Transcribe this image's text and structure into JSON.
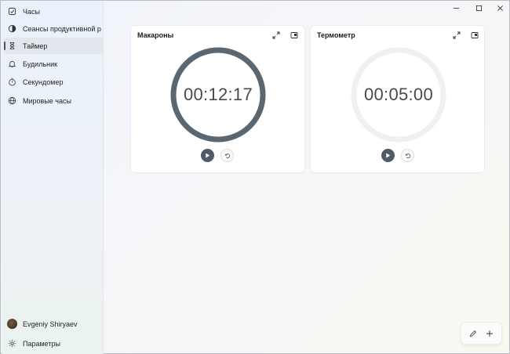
{
  "window": {
    "controls": [
      "minimize",
      "maximize",
      "close"
    ]
  },
  "sidebar": {
    "items": [
      {
        "label": "Часы",
        "icon": "clock-icon",
        "active": false
      },
      {
        "label": "Сеансы продуктивной р",
        "icon": "focus-icon",
        "active": false
      },
      {
        "label": "Таймер",
        "icon": "hourglass-icon",
        "active": true
      },
      {
        "label": "Будильник",
        "icon": "bell-icon",
        "active": false
      },
      {
        "label": "Секундомер",
        "icon": "stopwatch-icon",
        "active": false
      },
      {
        "label": "Мировые часы",
        "icon": "globe-icon",
        "active": false
      }
    ],
    "account": {
      "name": "Evgeniy Shiryaev",
      "icon": "avatar"
    },
    "settings": {
      "label": "Параметры",
      "icon": "gear-icon"
    }
  },
  "timers": [
    {
      "name": "Макароны",
      "time": "00:12:17",
      "progress": 1.0,
      "ring_color": "#5a6670"
    },
    {
      "name": "Термометр",
      "time": "00:05:00",
      "progress": 0.0,
      "ring_color": "#f0f0f0"
    }
  ],
  "colors": {
    "accent": "#4f5b66",
    "card_background": "#ffffff"
  }
}
